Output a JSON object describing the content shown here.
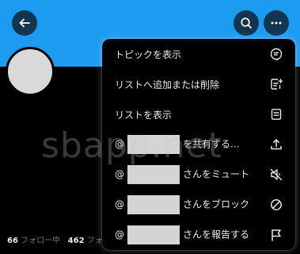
{
  "header": {
    "back_icon": "arrow-left-icon",
    "search_icon": "search-icon",
    "more_icon": "more-horizontal-icon",
    "banner_color": "#1d9bf0"
  },
  "profile": {
    "following_count": "66",
    "following_label": "フォロー中",
    "followers_count": "462",
    "followers_label": "フォ"
  },
  "watermark": "sbapp.net",
  "menu": {
    "items": [
      {
        "label": "トピックを表示",
        "icon": "topic-icon"
      },
      {
        "label": "リストへ追加または削除",
        "icon": "list-add-icon"
      },
      {
        "label": "リストを表示",
        "icon": "list-icon"
      },
      {
        "prefix": "@",
        "suffix": "を共有する...",
        "icon": "share-icon"
      },
      {
        "prefix": "@",
        "suffix": "さんをミュート",
        "icon": "mute-icon"
      },
      {
        "prefix": "@",
        "suffix": "さんをブロック",
        "icon": "block-icon"
      },
      {
        "prefix": "@",
        "suffix": "さんを報告する",
        "icon": "flag-icon"
      }
    ]
  }
}
